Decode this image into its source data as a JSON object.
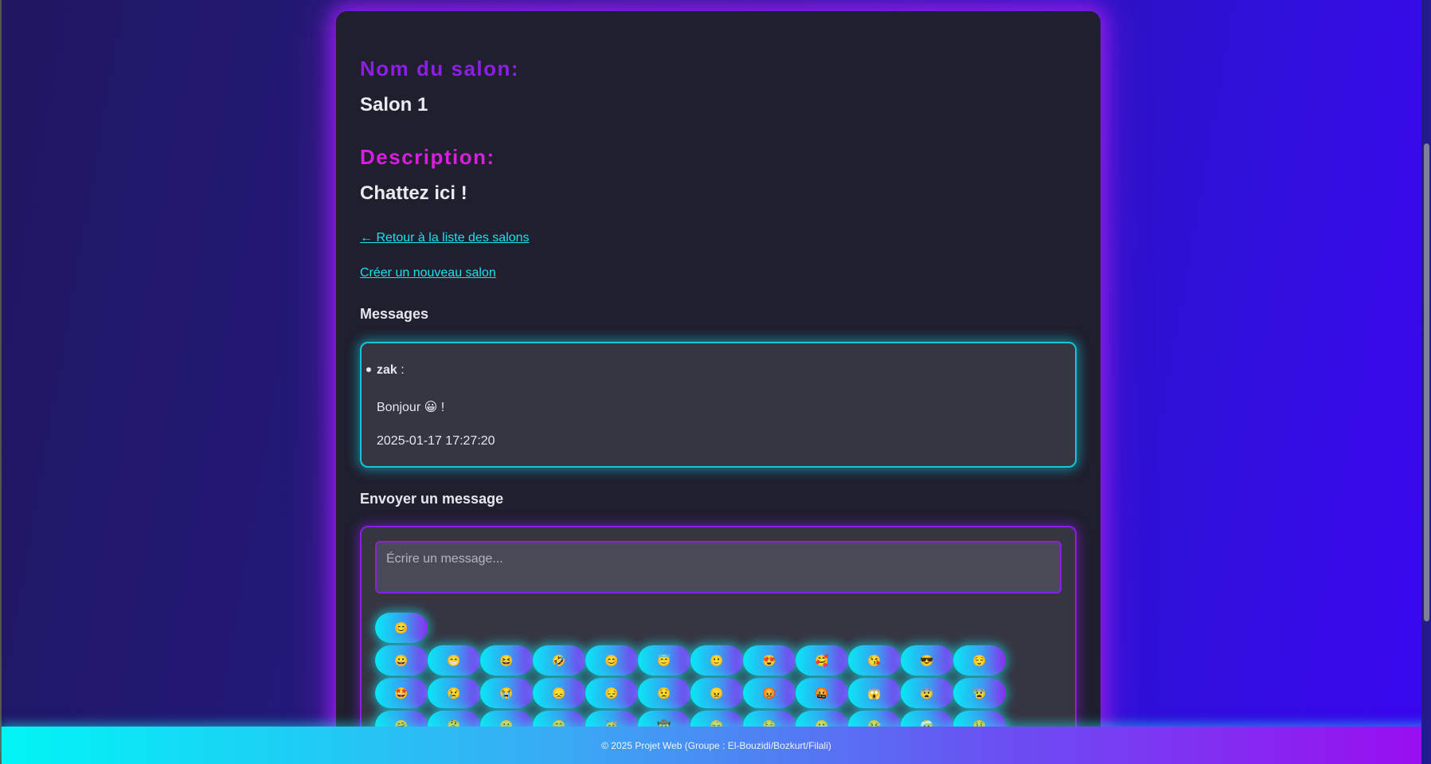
{
  "room": {
    "name_label": "Nom du salon:",
    "name": "Salon 1",
    "description_label": "Description:",
    "description": "Chattez ici !"
  },
  "links": {
    "back": "← Retour à la liste des salons",
    "create": "Créer un nouveau salon"
  },
  "messages": {
    "heading": "Messages",
    "items": [
      {
        "author": "zak",
        "separator": " :",
        "text": "Bonjour 😀 !",
        "date": "2025-01-17 17:27:20"
      }
    ]
  },
  "send": {
    "heading": "Envoyer un message",
    "placeholder": "Écrire un message...",
    "emoji_toggle": "😊",
    "emoji_rows": [
      [
        "😀",
        "😁",
        "😆",
        "🤣",
        "😊",
        "😇",
        "🙂",
        "😍",
        "🥰",
        "😘",
        "😎",
        "😌"
      ],
      [
        "🤩",
        "😢",
        "😭",
        "😞",
        "😔",
        "😟",
        "😠",
        "😡",
        "🤬",
        "😱",
        "😨",
        "😰"
      ],
      [
        "🤗",
        "🤔",
        "🤫",
        "🤭",
        "🥳",
        "🤠",
        "😴",
        "🤤",
        "😷",
        "🤒",
        "🤕",
        "🤑"
      ]
    ]
  },
  "footer": {
    "text": "© 2025 Projet Web (Groupe : El-Bouzidi/Bozkurt/Filali)"
  }
}
